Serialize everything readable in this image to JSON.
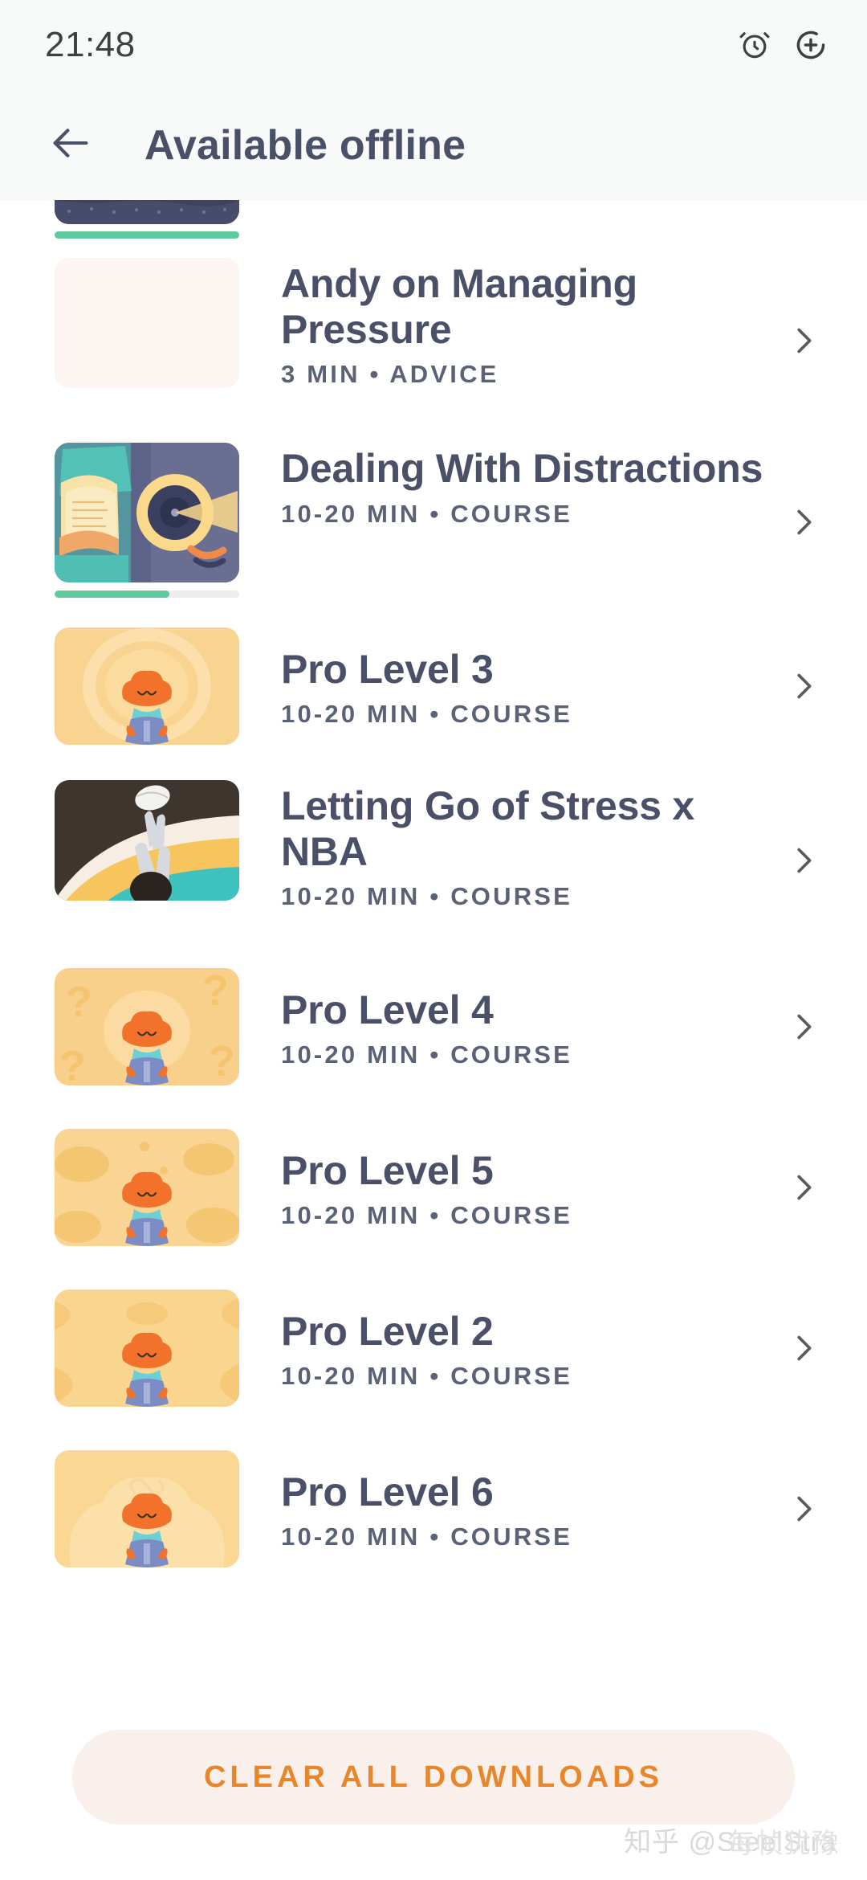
{
  "status_bar": {
    "time": "21:48",
    "icons": [
      "alarm-clock-icon",
      "circle-plus-icon"
    ]
  },
  "header": {
    "back_icon": "arrow-left-icon",
    "title": "Available offline"
  },
  "colors": {
    "header_bg": "#F8F9F9",
    "page_bg": "#FFFFFF",
    "title_text": "#4A5068",
    "meta_text": "#5B6275",
    "accent_orange": "#E8862C",
    "button_bg": "#FAF0EB",
    "progress_fill": "#5FC9A0",
    "chevron": "#5A5A5A"
  },
  "list": {
    "items": [
      {
        "title": "",
        "meta": "",
        "thumb": "night-sky-thumbnail",
        "clipped": true,
        "progress_percent": 100,
        "chevron_icon": "chevron-right-icon"
      },
      {
        "title": "Andy on Managing Pressure",
        "meta": "3 MIN • ADVICE",
        "thumb": "blank-pink-thumbnail",
        "clipped": false,
        "progress_percent": 0,
        "chevron_icon": "chevron-right-icon"
      },
      {
        "title": "Dealing With Distractions",
        "meta": "10-20 MIN • COURSE",
        "thumb": "book-target-thumbnail",
        "clipped": false,
        "progress_percent": 62,
        "chevron_icon": "chevron-right-icon"
      },
      {
        "title": "Pro Level 3",
        "meta": "10-20 MIN • COURSE",
        "thumb": "meditating-character-ring-thumbnail",
        "clipped": false,
        "progress_percent": 0,
        "chevron_icon": "chevron-right-icon"
      },
      {
        "title": "Letting Go of Stress x NBA",
        "meta": "10-20 MIN • COURSE",
        "thumb": "basketball-player-thumbnail",
        "clipped": false,
        "progress_percent": 0,
        "chevron_icon": "chevron-right-icon"
      },
      {
        "title": "Pro Level 4",
        "meta": "10-20 MIN • COURSE",
        "thumb": "meditating-character-questions-thumbnail",
        "clipped": false,
        "progress_percent": 0,
        "chevron_icon": "chevron-right-icon"
      },
      {
        "title": "Pro Level 5",
        "meta": "10-20 MIN • COURSE",
        "thumb": "meditating-character-clouds-thumbnail",
        "clipped": false,
        "progress_percent": 0,
        "chevron_icon": "chevron-right-icon"
      },
      {
        "title": "Pro Level 2",
        "meta": "10-20 MIN • COURSE",
        "thumb": "meditating-character-waves-thumbnail",
        "clipped": false,
        "progress_percent": 0,
        "chevron_icon": "chevron-right-icon"
      },
      {
        "title": "Pro Level 6",
        "meta": "10-20 MIN • COURSE",
        "thumb": "meditating-character-bigcloud-thumbnail",
        "clipped": false,
        "progress_percent": 0,
        "chevron_icon": "chevron-right-icon"
      }
    ]
  },
  "footer": {
    "clear_button_label": "CLEAR ALL DOWNLOADS"
  },
  "watermark": {
    "text": "知乎 @SteelStra",
    "overlay_text": "每帧犹豫"
  }
}
